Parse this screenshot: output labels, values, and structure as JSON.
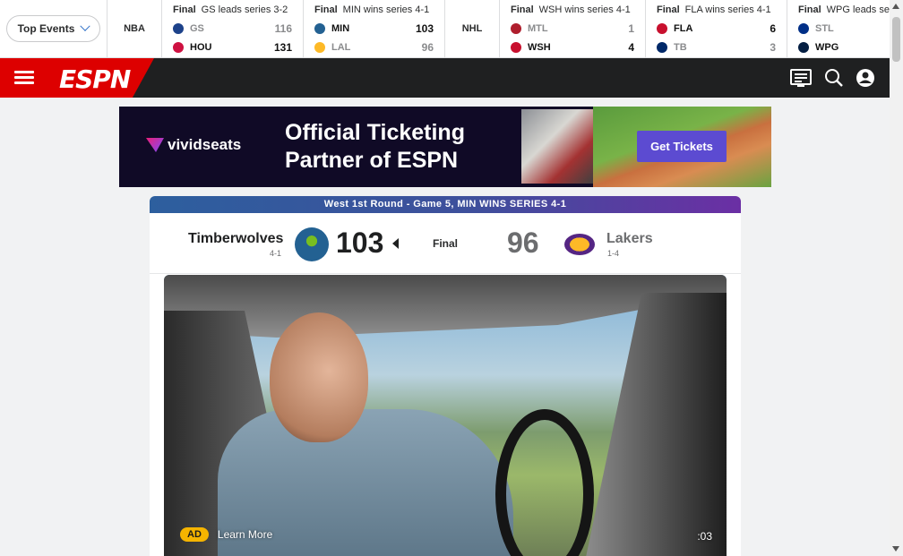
{
  "scoreboard": {
    "top_events_label": "Top Events",
    "leagues": {
      "nba": "NBA",
      "nhl": "NHL"
    },
    "games": [
      {
        "status": "Final",
        "note": "GS leads series 3-2",
        "teams": [
          {
            "abbr": "GS",
            "score": "116",
            "winner": false,
            "color": "#1d428a"
          },
          {
            "abbr": "HOU",
            "score": "131",
            "winner": true,
            "color": "#ce1141"
          }
        ]
      },
      {
        "status": "Final",
        "note": "MIN wins series 4-1",
        "teams": [
          {
            "abbr": "MIN",
            "score": "103",
            "winner": true,
            "color": "#236192"
          },
          {
            "abbr": "LAL",
            "score": "96",
            "winner": false,
            "color": "#fdb927"
          }
        ]
      },
      {
        "status": "Final",
        "note": "WSH wins series 4-1",
        "teams": [
          {
            "abbr": "MTL",
            "score": "1",
            "winner": false,
            "color": "#af1e2d"
          },
          {
            "abbr": "WSH",
            "score": "4",
            "winner": true,
            "color": "#c8102e"
          }
        ]
      },
      {
        "status": "Final",
        "note": "FLA wins series 4-1",
        "teams": [
          {
            "abbr": "FLA",
            "score": "6",
            "winner": true,
            "color": "#c8102e"
          },
          {
            "abbr": "TB",
            "score": "3",
            "winner": false,
            "color": "#002868"
          }
        ]
      },
      {
        "status": "Final",
        "note": "WPG leads se",
        "teams": [
          {
            "abbr": "STL",
            "score": "",
            "winner": false,
            "color": "#002f87"
          },
          {
            "abbr": "WPG",
            "score": "",
            "winner": true,
            "color": "#041e42"
          }
        ]
      }
    ]
  },
  "nav": {
    "logo_text": "ESPN",
    "icons": [
      "menu-icon",
      "scores-icon",
      "search-icon",
      "profile-icon"
    ]
  },
  "ad_banner": {
    "brand": "vividseats",
    "headline_line1": "Official Ticketing",
    "headline_line2": "Partner of ESPN",
    "cta": "Get Tickets"
  },
  "game_card": {
    "header": "West 1st Round - Game 5, MIN WINS SERIES 4-1",
    "status": "Final",
    "home": {
      "name": "Timberwolves",
      "record": "4-1",
      "score": "103",
      "logo_color": "#236192"
    },
    "away": {
      "name": "Lakers",
      "record": "1-4",
      "score": "96",
      "logo_color": "#552583"
    }
  },
  "video": {
    "ad_badge": "AD",
    "learn_more": "Learn More",
    "time": ":03"
  }
}
